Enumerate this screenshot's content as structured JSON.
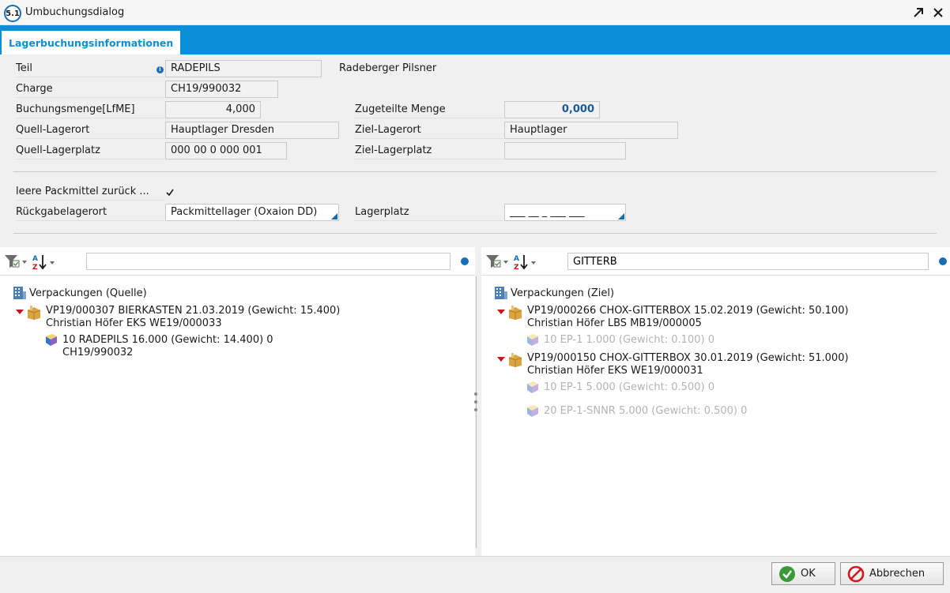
{
  "window": {
    "badge": "5.1",
    "title": "Umbuchungsdialog"
  },
  "tab": {
    "label": "Lagerbuchungsinformationen"
  },
  "form": {
    "teil_label": "Teil",
    "teil_value": "RADEPILS",
    "teil_description": "Radeberger Pilsner",
    "charge_label": "Charge",
    "charge_value": "CH19/990032",
    "buchungsmenge_label": "Buchungsmenge[LfME]",
    "buchungsmenge_value": "4,000",
    "zugeteilte_label": "Zugeteilte Menge",
    "zugeteilte_value": "0,000",
    "quell_lagerort_label": "Quell-Lagerort",
    "quell_lagerort_value": "Hauptlager Dresden",
    "ziel_lagerort_label": "Ziel-Lagerort",
    "ziel_lagerort_value": "Hauptlager",
    "quell_lagerplatz_label": "Quell-Lagerplatz",
    "quell_lagerplatz_value": "000 00 0 000 001",
    "ziel_lagerplatz_label": "Ziel-Lagerplatz",
    "ziel_lagerplatz_value": "",
    "packmittel_label": "leere Packmittel zurück ...",
    "packmittel_checked": true,
    "rueckgabe_label": "Rückgabelagerort",
    "rueckgabe_value": "Packmittellager (Oxaion DD)",
    "lagerplatz_label": "Lagerplatz",
    "lagerplatz_value": "___ __ _ ___ ___"
  },
  "left_panel": {
    "search_value": "",
    "root": "Verpackungen (Quelle)",
    "nodes": [
      {
        "line1": "VP19/000307 BIERKASTEN 21.03.2019 (Gewicht: 15.400)",
        "line2": "Christian Höfer EKS WE19/000033"
      },
      {
        "line1": "10 RADEPILS 16.000 (Gewicht: 14.400) 0",
        "line2": "CH19/990032"
      }
    ]
  },
  "right_panel": {
    "search_value": "GITTERB",
    "root": "Verpackungen (Ziel)",
    "nodes": [
      {
        "line1": "VP19/000266 CHOX-GITTERBOX 15.02.2019 (Gewicht: 50.100)",
        "line2": "Christian Höfer LBS MB19/000005"
      },
      {
        "line1": "10 EP-1 1.000 (Gewicht: 0.100) 0"
      },
      {
        "line1": "VP19/000150 CHOX-GITTERBOX 30.01.2019 (Gewicht: 51.000)",
        "line2": "Christian Höfer EKS WE19/000031"
      },
      {
        "line1": "10 EP-1 5.000 (Gewicht: 0.500) 0"
      },
      {
        "line1": "20 EP-1-SNNR 5.000 (Gewicht: 0.500) 0"
      }
    ]
  },
  "buttons": {
    "ok": "OK",
    "cancel": "Abbrechen"
  },
  "colors": {
    "accent": "#0a8fd6",
    "tree_expander": "#c0161c",
    "value_highlight": "#1c5a96"
  }
}
